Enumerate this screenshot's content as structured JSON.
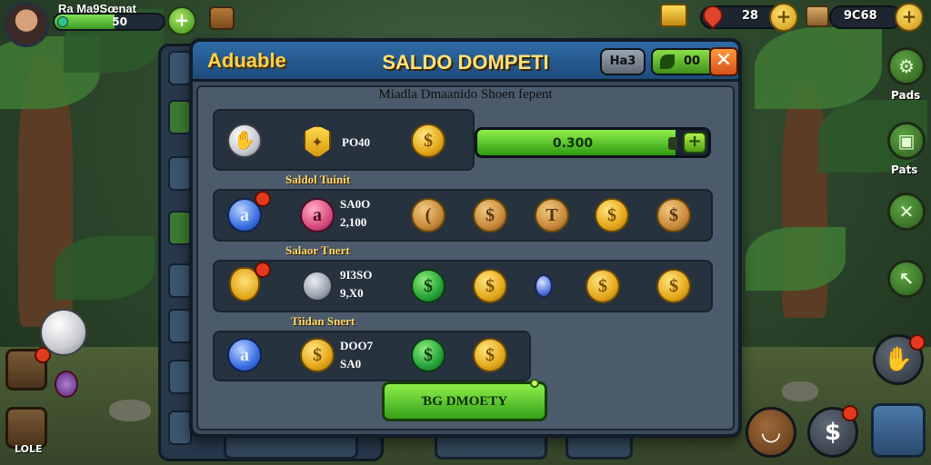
{
  "player": {
    "name": "Ra Ma9Sœnat",
    "xp_value": "50",
    "xp_fraction": 0.55
  },
  "resources": {
    "pins_value": "28",
    "gold_value": "9C68"
  },
  "side_menu": {
    "label_1": "Pads",
    "label_2": "Pats"
  },
  "left_menu": {
    "label_bottom": "LOLE"
  },
  "dialog": {
    "brand": "Aduable",
    "title": "SALDO DOMPETI",
    "header_grey_pill": "Ha3",
    "header_green_pill": "00",
    "close_symbol": "✕",
    "subtitle": "Miadla Dmaanido Shoen fepent",
    "row1": {
      "value": "PO40",
      "progress_text": "0.300",
      "progress_fraction": 0.86
    },
    "section2_label": "Saldol Tuinit",
    "row2": {
      "line1": "SA0O",
      "line2": "2,100"
    },
    "section3_label": "Salaor Tnert",
    "row3": {
      "line1": "9I3SO",
      "line2": "9,X0"
    },
    "section4_label": "Tiidan Snert",
    "row4": {
      "line1": "DOO7",
      "line2": "SA0"
    },
    "claim_button": "ƁG DMOETY"
  },
  "colors": {
    "header_blue": "#2e6ca8",
    "title_gold": "#ffe27a",
    "green_accent": "#3a9a22",
    "close_orange": "#d4501a"
  }
}
